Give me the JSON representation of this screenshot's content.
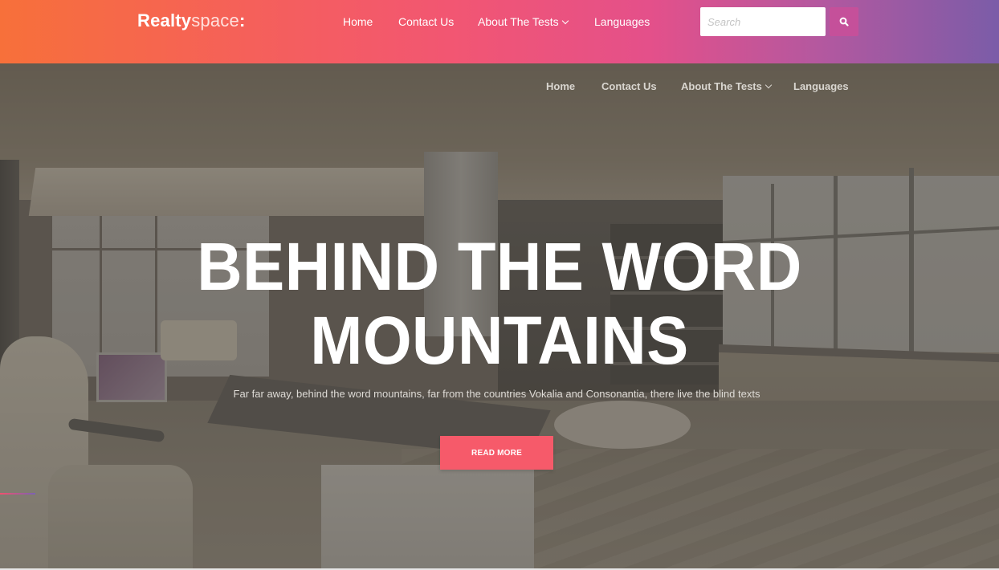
{
  "brand": {
    "part_bold": "Realty",
    "part_light": "space",
    "suffix": ":"
  },
  "header_nav": [
    {
      "label": "Home",
      "has_dropdown": false
    },
    {
      "label": "Contact Us",
      "has_dropdown": false
    },
    {
      "label": "About The Tests",
      "has_dropdown": true
    },
    {
      "label": "Languages",
      "has_dropdown": false
    }
  ],
  "search": {
    "placeholder": "Search",
    "value": "",
    "button_icon": "search-icon"
  },
  "hero_nav": [
    {
      "label": "Home",
      "has_dropdown": false
    },
    {
      "label": "Contact Us",
      "has_dropdown": false
    },
    {
      "label": "About The Tests",
      "has_dropdown": true
    },
    {
      "label": "Languages",
      "has_dropdown": false
    }
  ],
  "hero": {
    "title_line1": "BEHIND THE WORD",
    "title_line2": "MOUNTAINS",
    "subtitle": "Far far away, behind the word mountains, far from the countries Vokalia and Consonantia, there live the blind texts",
    "cta_label": "READ MORE",
    "background": "office-interior-photo"
  },
  "colors": {
    "header_gradient_start": "#f7703a",
    "header_gradient_mid": "#f25672",
    "header_gradient_end": "#7b5ca8",
    "search_button": "#c5509a",
    "cta": "#f65a6a"
  }
}
